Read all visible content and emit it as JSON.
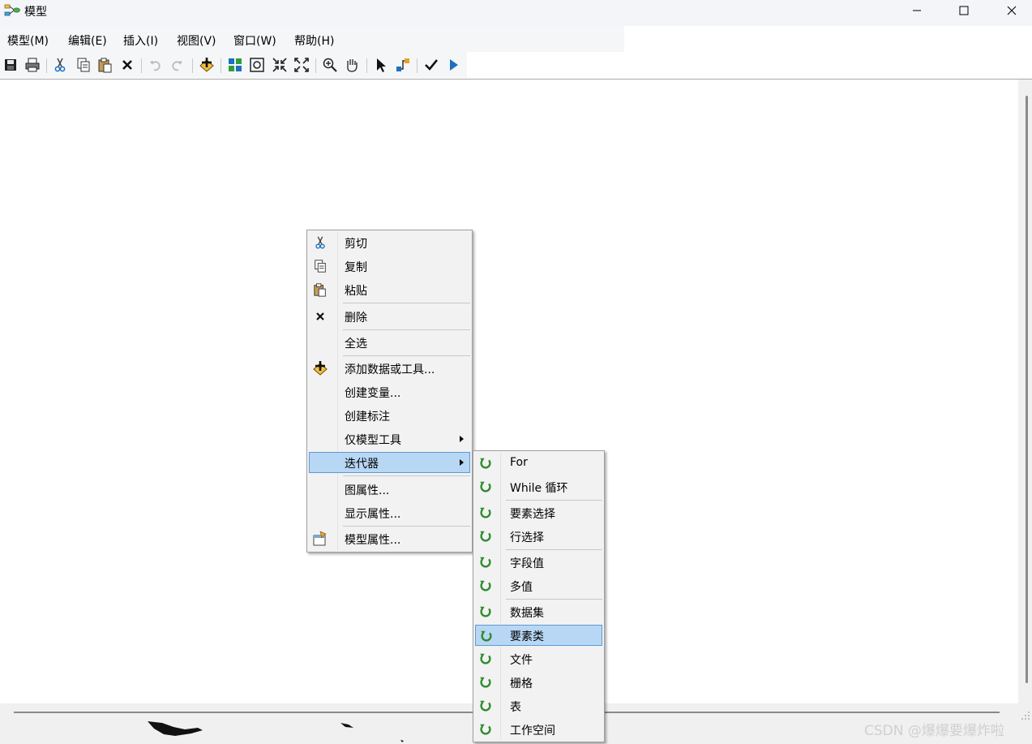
{
  "window": {
    "title": "模型",
    "icon": "model-builder-icon",
    "controls": [
      "minimize-icon",
      "maximize-icon",
      "close-icon"
    ]
  },
  "menubar": {
    "items": [
      {
        "label": "模型(M)"
      },
      {
        "label": "编辑(E)"
      },
      {
        "label": "插入(I)"
      },
      {
        "label": "视图(V)"
      },
      {
        "label": "窗口(W)"
      },
      {
        "label": "帮助(H)"
      }
    ]
  },
  "toolbar": {
    "buttons": [
      {
        "icon": "save-icon",
        "enabled": true
      },
      {
        "icon": "print-icon",
        "enabled": true
      },
      {
        "icon": "cut-icon",
        "enabled": true
      },
      {
        "icon": "copy-icon",
        "enabled": true
      },
      {
        "icon": "paste-icon",
        "enabled": true
      },
      {
        "icon": "delete-icon",
        "enabled": true
      },
      {
        "icon": "undo-icon",
        "enabled": false
      },
      {
        "icon": "redo-icon",
        "enabled": false
      },
      {
        "icon": "add-data-icon",
        "enabled": true
      },
      {
        "icon": "auto-layout-icon",
        "enabled": true
      },
      {
        "icon": "full-extent-icon",
        "enabled": true
      },
      {
        "icon": "fixed-zoom-in-icon",
        "enabled": true
      },
      {
        "icon": "fixed-zoom-out-icon",
        "enabled": true
      },
      {
        "icon": "zoom-in-icon",
        "enabled": true
      },
      {
        "icon": "pan-icon",
        "enabled": true
      },
      {
        "icon": "select-icon",
        "enabled": true
      },
      {
        "icon": "add-connection-icon",
        "enabled": true
      },
      {
        "icon": "validate-icon",
        "enabled": true
      },
      {
        "icon": "run-icon",
        "enabled": true
      }
    ]
  },
  "context_menu": {
    "items": [
      {
        "label": "剪切",
        "icon": "cut-icon"
      },
      {
        "label": "复制",
        "icon": "copy-icon"
      },
      {
        "label": "粘贴",
        "icon": "paste-icon"
      },
      {
        "label": "删除",
        "icon": "delete-icon"
      },
      {
        "label": "全选"
      },
      {
        "label": "添加数据或工具...",
        "icon": "add-data-icon"
      },
      {
        "label": "创建变量..."
      },
      {
        "label": "创建标注"
      },
      {
        "label": "仅模型工具",
        "submenu": true
      },
      {
        "label": "迭代器",
        "submenu": true,
        "highlighted": true
      },
      {
        "label": "图属性..."
      },
      {
        "label": "显示属性..."
      },
      {
        "label": "模型属性...",
        "icon": "model-properties-icon"
      }
    ]
  },
  "iterator_submenu": {
    "icon": "iterator-icon",
    "items": [
      {
        "label": "For"
      },
      {
        "label": "While 循环"
      },
      {
        "label": "要素选择"
      },
      {
        "label": "行选择"
      },
      {
        "label": "字段值"
      },
      {
        "label": "多值"
      },
      {
        "label": "数据集"
      },
      {
        "label": "要素类",
        "highlighted": true
      },
      {
        "label": "文件"
      },
      {
        "label": "栅格"
      },
      {
        "label": "表"
      },
      {
        "label": "工作空间"
      }
    ]
  },
  "watermark": "CSDN @爆爆要爆炸啦",
  "colors": {
    "highlight_bg": "#b8d7f4",
    "highlight_border": "#5a9bd6",
    "iterator_green": "#2e8b2e",
    "menu_bg": "#f2f2f2"
  }
}
